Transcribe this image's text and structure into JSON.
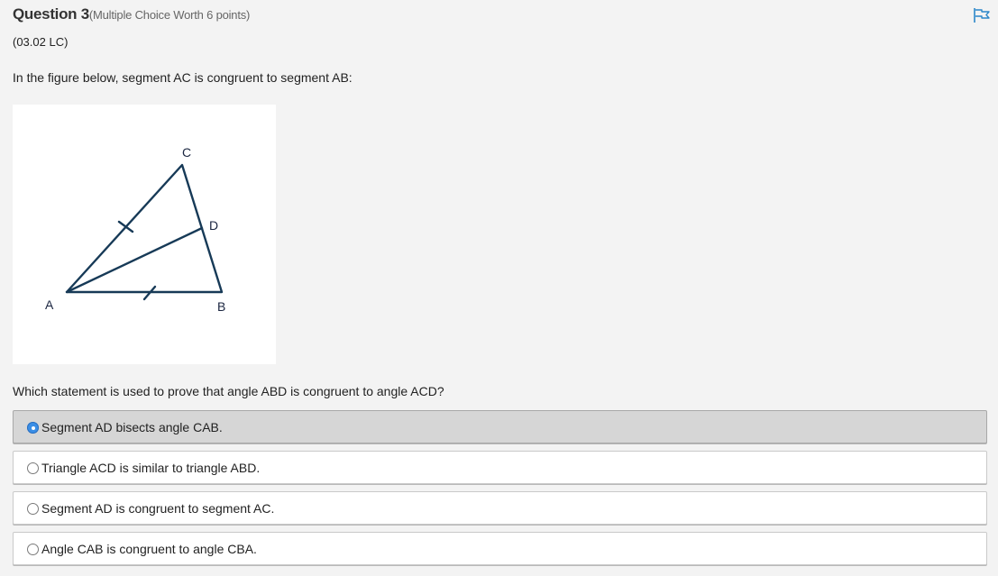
{
  "question": {
    "title": "Question 3",
    "worth": "(Multiple Choice Worth 6 points)",
    "code": "(03.02 LC)",
    "prompt": "In the figure below, segment AC is congruent to segment AB:",
    "question_text": "Which statement is used to prove that angle ABD is congruent to angle ACD?",
    "flag_icon": "flag-icon"
  },
  "figure": {
    "labels": {
      "A": "A",
      "B": "B",
      "C": "C",
      "D": "D"
    },
    "line_color": "#173a57"
  },
  "choices": [
    {
      "label": "Segment AD bisects angle CAB.",
      "selected": true
    },
    {
      "label": "Triangle ACD is similar to triangle ABD.",
      "selected": false
    },
    {
      "label": "Segment AD is congruent to segment AC.",
      "selected": false
    },
    {
      "label": "Angle CAB is congruent to angle CBA.",
      "selected": false
    }
  ],
  "colors": {
    "accent": "#3a8ee6",
    "selected_bg": "#d6d6d6",
    "page_bg": "#f3f3f3"
  }
}
